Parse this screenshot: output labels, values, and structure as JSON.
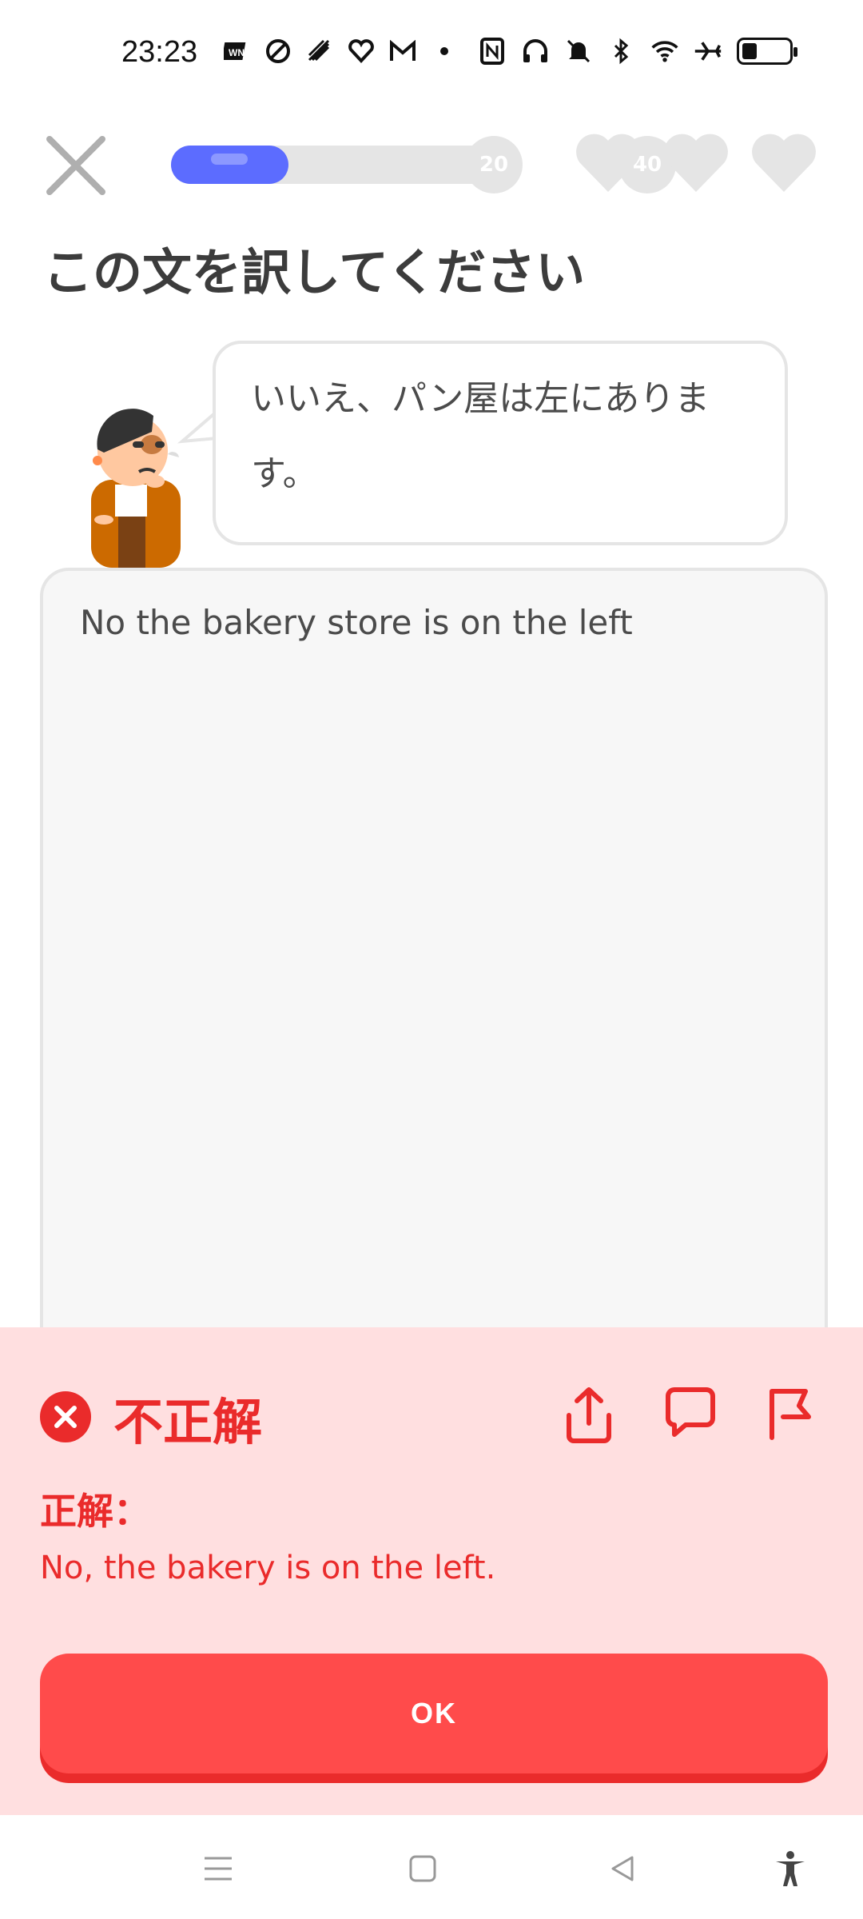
{
  "status_bar": {
    "time": "23:23",
    "left_icons": [
      "app-icon-1",
      "app-icon-2",
      "app-icon-3",
      "app-icon-4",
      "gmail-icon",
      "dot-icon"
    ],
    "right_icons": [
      "nfc-icon",
      "headphones-icon",
      "mute-icon",
      "bluetooth-icon",
      "wifi-icon",
      "airplane-icon",
      "battery-icon"
    ]
  },
  "header": {
    "progress": {
      "fraction": 0.34,
      "milestones": [
        "20",
        "40"
      ]
    },
    "hearts": 3
  },
  "prompt": {
    "title": "この文を訳してください",
    "sentence": "いいえ、パン屋は左にあります。"
  },
  "answer": {
    "user_text": "No the bakery store is on the left"
  },
  "feedback": {
    "status": "不正解",
    "label": "正解：",
    "correct_answer": "No, the bakery is on the left.",
    "ok_label": "OK"
  },
  "colors": {
    "accent_blue": "#5c6cff",
    "error_red": "#ea2b2b",
    "button_red": "#ff4b4b",
    "feedback_bg": "#ffdfe0"
  }
}
